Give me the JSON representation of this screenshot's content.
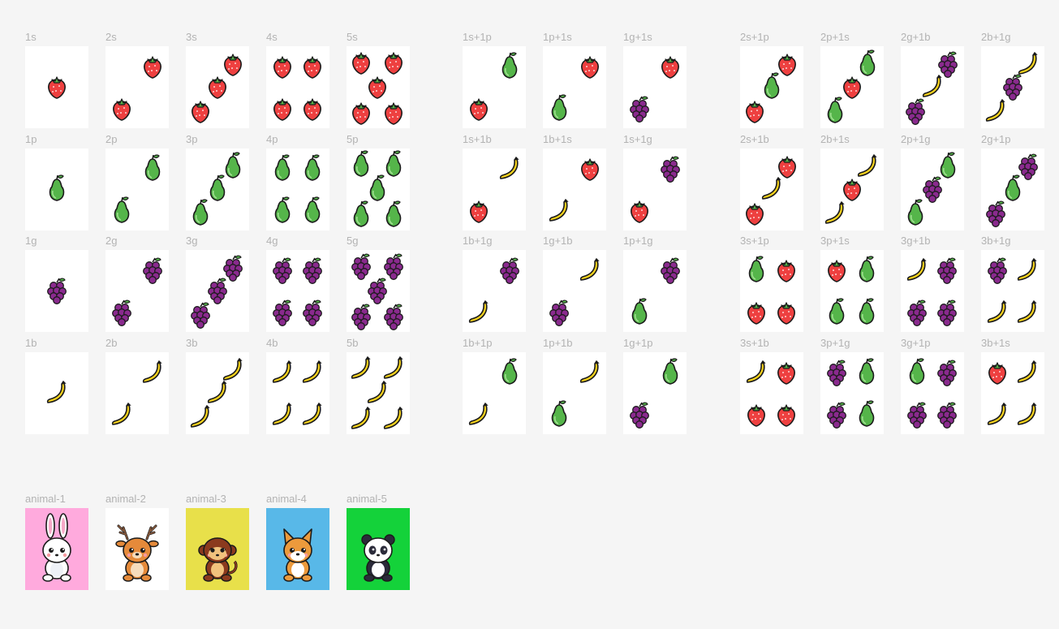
{
  "canvas_bg": "#f5f5f5",
  "colors": {
    "strawberry": "#ee4040",
    "pear": "#55b54a",
    "grape": "#8a2a8e",
    "banana": "#f7d31c",
    "outline": "#1b1b1b"
  },
  "fruit_codes": {
    "s": "strawberry",
    "p": "pear",
    "g": "grape",
    "b": "banana"
  },
  "frames": [
    {
      "label": "1s",
      "items": [
        "s"
      ]
    },
    {
      "label": "2s",
      "items": [
        "s",
        "s"
      ]
    },
    {
      "label": "3s",
      "items": [
        "s",
        "s",
        "s"
      ]
    },
    {
      "label": "4s",
      "items": [
        "s",
        "s",
        "s",
        "s"
      ]
    },
    {
      "label": "5s",
      "items": [
        "s",
        "s",
        "s",
        "s",
        "s"
      ]
    },
    {
      "label": "1s+1p",
      "items": [
        "p",
        "s"
      ]
    },
    {
      "label": "1p+1s",
      "items": [
        "s",
        "p"
      ]
    },
    {
      "label": "1g+1s",
      "items": [
        "s",
        "g"
      ]
    },
    {
      "label": "2s+1p",
      "items": [
        "s",
        "p",
        "s"
      ]
    },
    {
      "label": "2p+1s",
      "items": [
        "p",
        "s",
        "p"
      ]
    },
    {
      "label": "2g+1b",
      "items": [
        "g",
        "b",
        "g"
      ]
    },
    {
      "label": "2b+1g",
      "items": [
        "b",
        "g",
        "b"
      ]
    },
    {
      "label": "1p",
      "items": [
        "p"
      ]
    },
    {
      "label": "2p",
      "items": [
        "p",
        "p"
      ]
    },
    {
      "label": "3p",
      "items": [
        "p",
        "p",
        "p"
      ]
    },
    {
      "label": "4p",
      "items": [
        "p",
        "p",
        "p",
        "p"
      ]
    },
    {
      "label": "5p",
      "items": [
        "p",
        "p",
        "p",
        "p",
        "p"
      ]
    },
    {
      "label": "1s+1b",
      "items": [
        "b",
        "s"
      ]
    },
    {
      "label": "1b+1s",
      "items": [
        "s",
        "b"
      ]
    },
    {
      "label": "1s+1g",
      "items": [
        "g",
        "s"
      ]
    },
    {
      "label": "2s+1b",
      "items": [
        "s",
        "b",
        "s"
      ]
    },
    {
      "label": "2b+1s",
      "items": [
        "b",
        "s",
        "b"
      ]
    },
    {
      "label": "2p+1g",
      "items": [
        "p",
        "g",
        "p"
      ]
    },
    {
      "label": "2g+1p",
      "items": [
        "g",
        "p",
        "g"
      ]
    },
    {
      "label": "1g",
      "items": [
        "g"
      ]
    },
    {
      "label": "2g",
      "items": [
        "g",
        "g"
      ]
    },
    {
      "label": "3g",
      "items": [
        "g",
        "g",
        "g"
      ]
    },
    {
      "label": "4g",
      "items": [
        "g",
        "g",
        "g",
        "g"
      ]
    },
    {
      "label": "5g",
      "items": [
        "g",
        "g",
        "g",
        "g",
        "g"
      ]
    },
    {
      "label": "1b+1g",
      "items": [
        "g",
        "b"
      ]
    },
    {
      "label": "1g+1b",
      "items": [
        "b",
        "g"
      ]
    },
    {
      "label": "1p+1g",
      "items": [
        "g",
        "p"
      ]
    },
    {
      "label": "3s+1p",
      "items": [
        "p",
        "s",
        "s",
        "s"
      ]
    },
    {
      "label": "3p+1s",
      "items": [
        "s",
        "p",
        "p",
        "p"
      ]
    },
    {
      "label": "3g+1b",
      "items": [
        "b",
        "g",
        "g",
        "g"
      ]
    },
    {
      "label": "3b+1g",
      "items": [
        "g",
        "b",
        "b",
        "b"
      ]
    },
    {
      "label": "1b",
      "items": [
        "b"
      ]
    },
    {
      "label": "2b",
      "items": [
        "b",
        "b"
      ]
    },
    {
      "label": "3b",
      "items": [
        "b",
        "b",
        "b"
      ]
    },
    {
      "label": "4b",
      "items": [
        "b",
        "b",
        "b",
        "b"
      ]
    },
    {
      "label": "5b",
      "items": [
        "b",
        "b",
        "b",
        "b",
        "b"
      ]
    },
    {
      "label": "1b+1p",
      "items": [
        "p",
        "b"
      ]
    },
    {
      "label": "1p+1b",
      "items": [
        "b",
        "p"
      ]
    },
    {
      "label": "1g+1p",
      "items": [
        "p",
        "g"
      ]
    },
    {
      "label": "3s+1b",
      "items": [
        "b",
        "s",
        "s",
        "s"
      ]
    },
    {
      "label": "3p+1g",
      "items": [
        "g",
        "p",
        "g",
        "p"
      ]
    },
    {
      "label": "3g+1p",
      "items": [
        "p",
        "g",
        "g",
        "g"
      ]
    },
    {
      "label": "3b+1s",
      "items": [
        "s",
        "b",
        "b",
        "b"
      ]
    }
  ],
  "animals": [
    {
      "label": "animal-1",
      "animal": "rabbit",
      "bg": "#ffaadd"
    },
    {
      "label": "animal-2",
      "animal": "deer",
      "bg": "#ffffff"
    },
    {
      "label": "animal-3",
      "animal": "monkey",
      "bg": "#e8e04a"
    },
    {
      "label": "animal-4",
      "animal": "dog",
      "bg": "#58b8e8"
    },
    {
      "label": "animal-5",
      "animal": "panda",
      "bg": "#14d23a"
    }
  ]
}
